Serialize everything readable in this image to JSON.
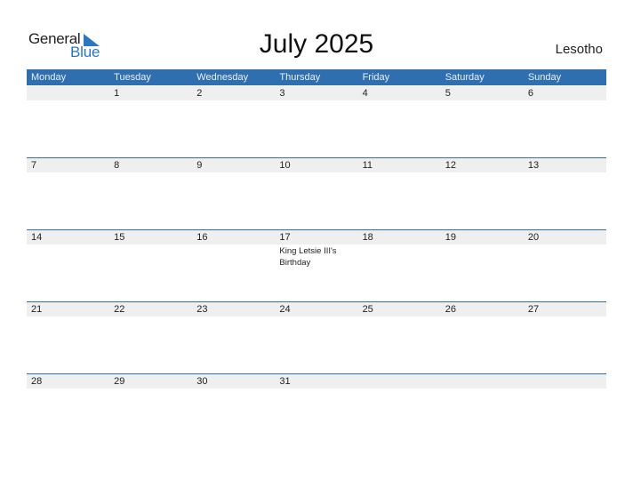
{
  "logo": {
    "general": "General",
    "blue": "Blue"
  },
  "title": "July 2025",
  "country": "Lesotho",
  "colors": {
    "header_bg": "#2f6fb0",
    "accent": "#2a78c2",
    "band": "#efefef"
  },
  "weekdays": [
    "Monday",
    "Tuesday",
    "Wednesday",
    "Thursday",
    "Friday",
    "Saturday",
    "Sunday"
  ],
  "weeks": [
    {
      "days": [
        {
          "num": ""
        },
        {
          "num": "1"
        },
        {
          "num": "2"
        },
        {
          "num": "3"
        },
        {
          "num": "4"
        },
        {
          "num": "5"
        },
        {
          "num": "6"
        }
      ]
    },
    {
      "days": [
        {
          "num": "7"
        },
        {
          "num": "8"
        },
        {
          "num": "9"
        },
        {
          "num": "10"
        },
        {
          "num": "11"
        },
        {
          "num": "12"
        },
        {
          "num": "13"
        }
      ]
    },
    {
      "days": [
        {
          "num": "14"
        },
        {
          "num": "15"
        },
        {
          "num": "16"
        },
        {
          "num": "17",
          "event": "King Letsie III's Birthday"
        },
        {
          "num": "18"
        },
        {
          "num": "19"
        },
        {
          "num": "20"
        }
      ]
    },
    {
      "days": [
        {
          "num": "21"
        },
        {
          "num": "22"
        },
        {
          "num": "23"
        },
        {
          "num": "24"
        },
        {
          "num": "25"
        },
        {
          "num": "26"
        },
        {
          "num": "27"
        }
      ]
    },
    {
      "days": [
        {
          "num": "28"
        },
        {
          "num": "29"
        },
        {
          "num": "30"
        },
        {
          "num": "31"
        },
        {
          "num": ""
        },
        {
          "num": ""
        },
        {
          "num": ""
        }
      ]
    }
  ]
}
